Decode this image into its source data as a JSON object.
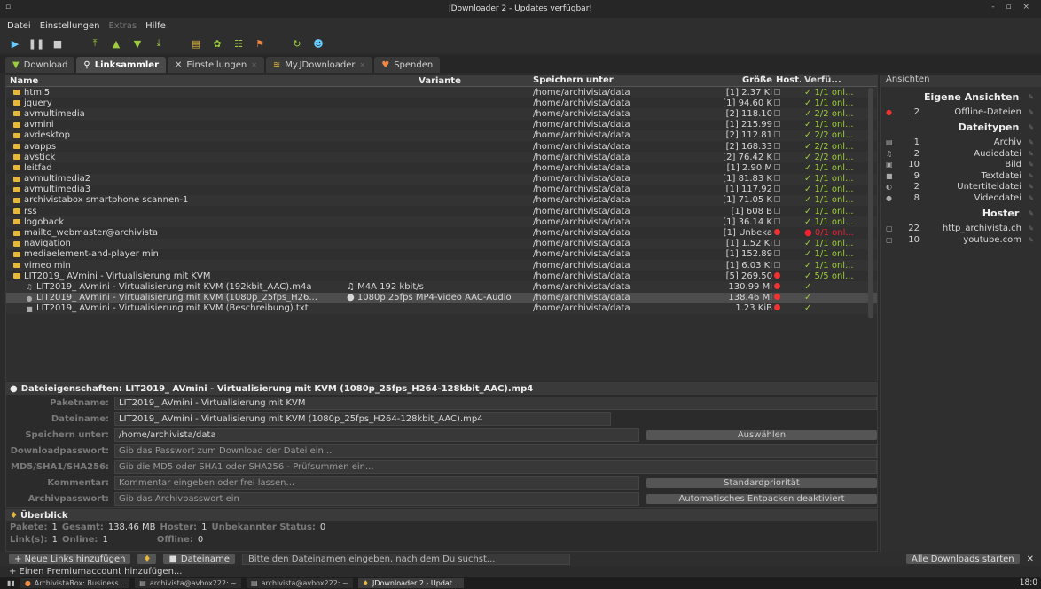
{
  "window": {
    "title": "JDownloader 2 - Updates verfügbar!",
    "controls": "- ▫ ×"
  },
  "menu": [
    {
      "label": "Datei",
      "disabled": false
    },
    {
      "label": "Einstellungen",
      "disabled": false
    },
    {
      "label": "Extras",
      "disabled": true
    },
    {
      "label": "Hilfe",
      "disabled": false
    }
  ],
  "tabs": [
    {
      "label": "Download",
      "icon": "▼",
      "color": "#9ccc3c",
      "active": false
    },
    {
      "label": "Linksammler",
      "icon": "⚲",
      "color": "#ddd",
      "active": true
    },
    {
      "label": "Einstellungen",
      "icon": "✕",
      "color": "#ddd",
      "active": false
    },
    {
      "label": "My.JDownloader",
      "icon": "≋",
      "color": "#e6b73a",
      "active": false
    },
    {
      "label": "Spenden",
      "icon": "♥",
      "color": "#e84",
      "active": false
    }
  ],
  "columns": {
    "name": "Name",
    "variant": "Variante",
    "path": "Speichern unter",
    "size": "Größe",
    "host": "Host...",
    "avail": "Verfü..."
  },
  "rows": [
    {
      "type": "pkg",
      "name": "html5",
      "variant": "",
      "path": "/home/archivista/data",
      "size": "[1] 2.37 Ki",
      "avail": "✓ 1/1 onl...",
      "status": "ok"
    },
    {
      "type": "pkg",
      "name": "jquery",
      "variant": "",
      "path": "/home/archivista/data",
      "size": "[1] 94.60 K",
      "avail": "✓ 1/1 onl...",
      "status": "ok"
    },
    {
      "type": "pkg",
      "name": "avmultimedia",
      "variant": "",
      "path": "/home/archivista/data",
      "size": "[2] 118.10",
      "avail": "✓ 2/2 onl...",
      "status": "ok"
    },
    {
      "type": "pkg",
      "name": "avmini",
      "variant": "",
      "path": "/home/archivista/data",
      "size": "[1] 215.99",
      "avail": "✓ 1/1 onl...",
      "status": "ok"
    },
    {
      "type": "pkg",
      "name": "avdesktop",
      "variant": "",
      "path": "/home/archivista/data",
      "size": "[2] 112.81",
      "avail": "✓ 2/2 onl...",
      "status": "ok"
    },
    {
      "type": "pkg",
      "name": "avapps",
      "variant": "",
      "path": "/home/archivista/data",
      "size": "[2] 168.33",
      "avail": "✓ 2/2 onl...",
      "status": "ok"
    },
    {
      "type": "pkg",
      "name": "avstick",
      "variant": "",
      "path": "/home/archivista/data",
      "size": "[2] 76.42 K",
      "avail": "✓ 2/2 onl...",
      "status": "ok"
    },
    {
      "type": "pkg",
      "name": "leitfad",
      "variant": "",
      "path": "/home/archivista/data",
      "size": "[1] 2.90 M",
      "avail": "✓ 1/1 onl...",
      "status": "ok"
    },
    {
      "type": "pkg",
      "name": "avmultimedia2",
      "variant": "",
      "path": "/home/archivista/data",
      "size": "[1] 81.83 K",
      "avail": "✓ 1/1 onl...",
      "status": "ok"
    },
    {
      "type": "pkg",
      "name": "avmultimedia3",
      "variant": "",
      "path": "/home/archivista/data",
      "size": "[1] 117.92",
      "avail": "✓ 1/1 onl...",
      "status": "ok"
    },
    {
      "type": "pkg",
      "name": "archivistabox smartphone scannen-1",
      "variant": "",
      "path": "/home/archivista/data",
      "size": "[1] 71.05 K",
      "avail": "✓ 1/1 onl...",
      "status": "ok"
    },
    {
      "type": "pkg",
      "name": "rss",
      "variant": "",
      "path": "/home/archivista/data",
      "size": "[1] 608 B",
      "avail": "✓ 1/1 onl...",
      "status": "ok"
    },
    {
      "type": "pkg",
      "name": "logoback",
      "variant": "",
      "path": "/home/archivista/data",
      "size": "[1] 36.14 K",
      "avail": "✓ 1/1 onl...",
      "status": "ok"
    },
    {
      "type": "pkg",
      "name": "mailto_webmaster@archivista",
      "variant": "",
      "path": "/home/archivista/data",
      "size": "[1] Unbeka",
      "avail": "● 0/1 onl...",
      "status": "bad"
    },
    {
      "type": "pkg",
      "name": "navigation",
      "variant": "",
      "path": "/home/archivista/data",
      "size": "[1] 1.52 Ki",
      "avail": "✓ 1/1 onl...",
      "status": "ok"
    },
    {
      "type": "pkg",
      "name": "mediaelement-and-player min",
      "variant": "",
      "path": "/home/archivista/data",
      "size": "[1] 152.89",
      "avail": "✓ 1/1 onl...",
      "status": "ok"
    },
    {
      "type": "pkg",
      "name": "vimeo min",
      "variant": "",
      "path": "/home/archivista/data",
      "size": "[1] 6.03 Ki",
      "avail": "✓ 1/1 onl...",
      "status": "ok"
    },
    {
      "type": "pkg",
      "name": "LIT2019_ AVmini - Virtualisierung mit KVM",
      "variant": "",
      "path": "/home/archivista/data",
      "size": "[5] 269.50",
      "avail": "✓ 5/5 onl...",
      "status": "ok"
    },
    {
      "type": "child",
      "icon": "♫",
      "name": "LIT2019_ AVmini - Virtualisierung mit KVM (192kbit_AAC).m4a",
      "variant": "♫ M4A 192 kbit/s",
      "path": "/home/archivista/data",
      "size": "130.99 Mi",
      "avail": "✓",
      "status": "ok"
    },
    {
      "type": "child",
      "icon": "●",
      "name": "LIT2019_ AVmini - Virtualisierung mit KVM (1080p_25fps_H26...",
      "variant": "● 1080p 25fps MP4-Video AAC-Audio",
      "path": "/home/archivista/data",
      "size": "138.46 Mi",
      "avail": "✓",
      "status": "ok",
      "selected": true
    },
    {
      "type": "child",
      "icon": "■",
      "name": "LIT2019_ AVmini - Virtualisierung mit KVM (Beschreibung).txt",
      "variant": "",
      "path": "/home/archivista/data",
      "size": "1.23 KiB",
      "avail": "✓",
      "status": "ok"
    }
  ],
  "sidebar": {
    "header": "Ansichten",
    "groups": [
      {
        "title": "Eigene Ansichten",
        "items": [
          {
            "icon": "●",
            "count": "2",
            "label": "Offline-Dateien"
          }
        ]
      },
      {
        "title": "Dateitypen",
        "items": [
          {
            "icon": "▤",
            "count": "1",
            "label": "Archiv"
          },
          {
            "icon": "♫",
            "count": "2",
            "label": "Audiodatei"
          },
          {
            "icon": "▣",
            "count": "10",
            "label": "Bild"
          },
          {
            "icon": "■",
            "count": "9",
            "label": "Textdatei"
          },
          {
            "icon": "◐",
            "count": "2",
            "label": "Untertiteldatei"
          },
          {
            "icon": "●",
            "count": "8",
            "label": "Videodatei"
          }
        ]
      },
      {
        "title": "Hoster",
        "items": [
          {
            "icon": "▢",
            "count": "22",
            "label": "http_archivista.ch"
          },
          {
            "icon": "▢",
            "count": "10",
            "label": "youtube.com"
          }
        ]
      }
    ]
  },
  "props": {
    "title": "Dateieigenschaften: LIT2019_ AVmini - Virtualisierung mit KVM (1080p_25fps_H264-128kbit_AAC).mp4",
    "package_label": "Paketname:",
    "package_value": "LIT2019_ AVmini - Virtualisierung mit KVM",
    "file_label": "Dateiname:",
    "file_value": "LIT2019_ AVmini - Virtualisierung mit KVM (1080p_25fps_H264-128kbit_AAC).mp4",
    "save_label": "Speichern unter:",
    "save_value": "/home/archivista/data",
    "save_button": "Auswählen",
    "pw_label": "Downloadpasswort:",
    "pw_value": "Gib das Passwort zum Download der Datei ein...",
    "hash_label": "MD5/SHA1/SHA256:",
    "hash_value": "Gib die MD5 oder SHA1 oder SHA256 - Prüfsummen ein...",
    "comment_label": "Kommentar:",
    "comment_value": "Kommentar eingeben oder frei lassen...",
    "priority_button": "Standardpriorität",
    "archive_label": "Archivpasswort:",
    "archive_value": "Gib das Archivpasswort ein",
    "extract_button": "Automatisches Entpacken deaktiviert"
  },
  "overview": {
    "title": "Überblick",
    "packages_k": "Pakete:",
    "packages_v": "1",
    "total_k": "Gesamt:",
    "total_v": "138.46 MB",
    "hoster_k": "Hoster:",
    "hoster_v": "1",
    "unknown_k": "Unbekannter Status:",
    "unknown_v": "0",
    "links_k": "Link(s):",
    "links_v": "1",
    "online_k": "Online:",
    "online_v": "1",
    "offline_k": "Offline:",
    "offline_v": "0"
  },
  "bottom": {
    "add_links": "+ Neue Links hinzufügen",
    "filename": "Dateiname",
    "search_placeholder": "Bitte den Dateinamen eingeben, nach dem Du suchst...",
    "start_all": "Alle Downloads starten",
    "premium": "+ Einen Premiumaccount hinzufügen..."
  },
  "taskbar": {
    "tasks": [
      "ArchivistaBox: Business...",
      "archivista@avbox222: ~",
      "archivista@avbox222: ~",
      "JDownloader 2 - Updat..."
    ],
    "clock": "18:0"
  }
}
